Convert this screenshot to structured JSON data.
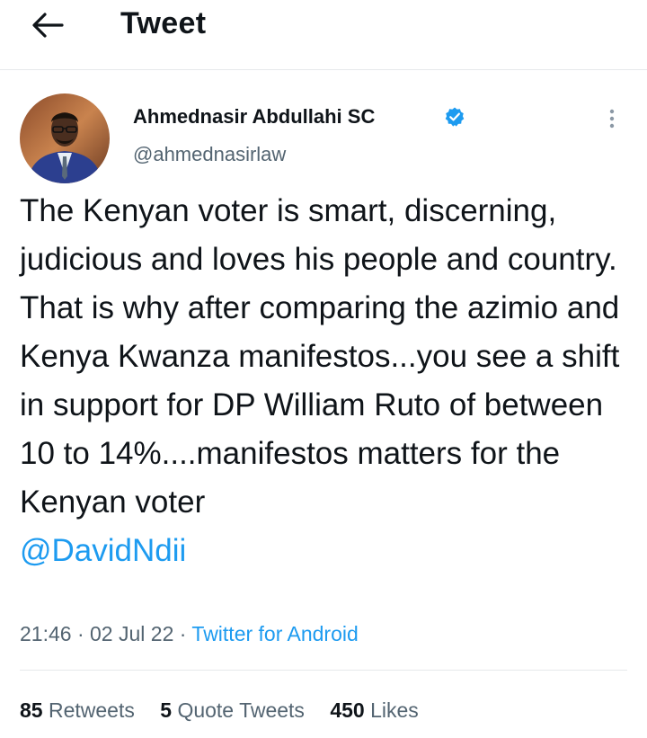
{
  "header": {
    "title": "Tweet",
    "back_icon": "arrow-left-icon"
  },
  "tweet": {
    "author_name": "Ahmednasir Abdullahi SC",
    "verified_icon": "verified-badge-icon",
    "handle": "@ahmednasirlaw",
    "more_icon": "more-vertical-icon",
    "text": "The Kenyan voter is smart, discerning, judicious and loves his people and country. That is why after comparing the azimio and Kenya Kwanza manifestos...you see a shift in support for DP William Ruto of between 10 to 14%....manifestos matters for the Kenyan voter",
    "mention": "@DavidNdii",
    "time": "21:46",
    "separator": "·",
    "date": "02 Jul 22",
    "source": "Twitter for Android"
  },
  "stats": {
    "retweets_count": "85",
    "retweets_label": "Retweets",
    "quotes_count": "5",
    "quotes_label": "Quote Tweets",
    "likes_count": "450",
    "likes_label": "Likes"
  },
  "colors": {
    "accent": "#1d9bf0",
    "secondary_text": "#536471",
    "primary_text": "#0f1419"
  }
}
